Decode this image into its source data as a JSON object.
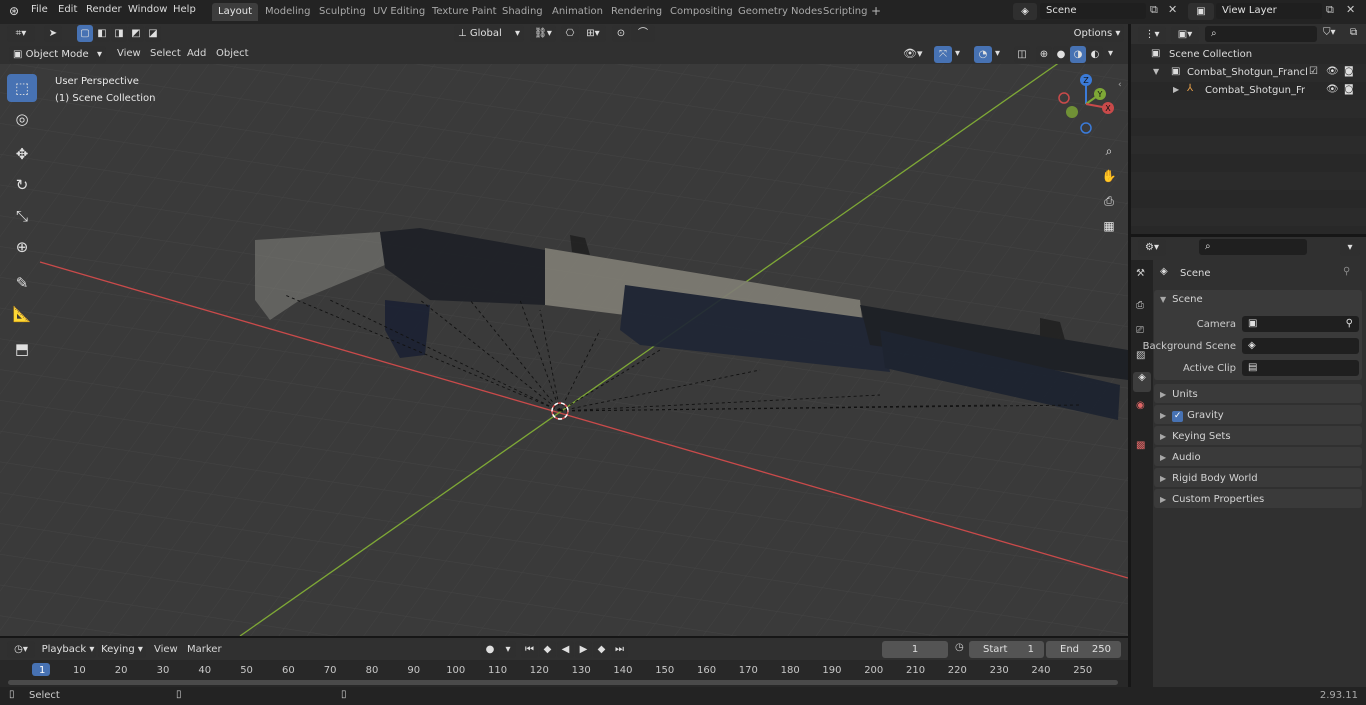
{
  "menu": [
    "File",
    "Edit",
    "Render",
    "Window",
    "Help"
  ],
  "workspaces": [
    "Layout",
    "Modeling",
    "Sculpting",
    "UV Editing",
    "Texture Paint",
    "Shading",
    "Animation",
    "Rendering",
    "Compositing",
    "Geometry Nodes",
    "Scripting"
  ],
  "active_workspace": "Layout",
  "add_workspace_label": "+",
  "scene_field": "Scene",
  "view_layer_field": "View Layer",
  "viewport_header": {
    "mode": "Object Mode",
    "menus": [
      "View",
      "Select",
      "Add",
      "Object"
    ],
    "transform_orientation": "Global",
    "options_label": "Options"
  },
  "viewport_overlay": {
    "perspective": "User Perspective",
    "collection": "(1) Scene Collection"
  },
  "gizmo_labels": {
    "z": "Z",
    "y": "Y",
    "x": "X"
  },
  "outliner": {
    "search_placeholder": "",
    "root": "Scene Collection",
    "items": [
      {
        "label": "Combat_Shotgun_Franchi_SP"
      },
      {
        "label": "Combat_Shotgun_Franch"
      }
    ]
  },
  "properties": {
    "context": "Scene",
    "panel": "Scene",
    "fields": [
      {
        "label": "Camera",
        "value": ""
      },
      {
        "label": "Background Scene",
        "value": ""
      },
      {
        "label": "Active Clip",
        "value": ""
      }
    ],
    "subpanels": [
      "Units",
      "Gravity",
      "Keying Sets",
      "Audio",
      "Rigid Body World",
      "Custom Properties"
    ],
    "gravity_checked": true
  },
  "timeline": {
    "menus": [
      "Playback",
      "Keying",
      "View",
      "Marker"
    ],
    "current_frame": "1",
    "start_label": "Start",
    "start_value": "1",
    "end_label": "End",
    "end_value": "250",
    "ticks": [
      "1",
      "10",
      "20",
      "30",
      "40",
      "50",
      "60",
      "70",
      "80",
      "90",
      "100",
      "110",
      "120",
      "130",
      "140",
      "150",
      "160",
      "170",
      "180",
      "190",
      "200",
      "210",
      "220",
      "230",
      "240",
      "250"
    ]
  },
  "status": {
    "left": "Select",
    "version": "2.93.11"
  },
  "colors": {
    "accent": "#4772b3",
    "x_axis": "#c94a4a",
    "y_axis": "#7ea836"
  }
}
